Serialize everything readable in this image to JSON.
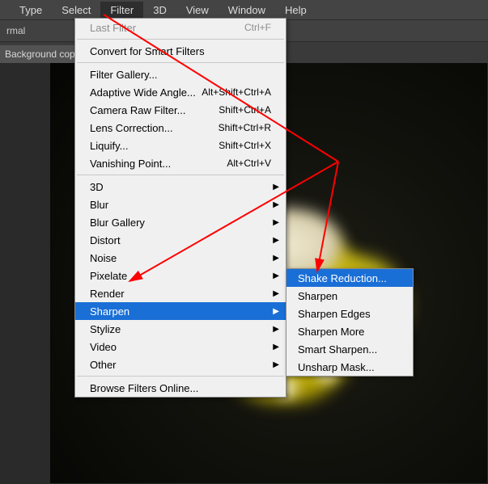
{
  "menubar": {
    "items": [
      "Type",
      "Select",
      "Filter",
      "3D",
      "View",
      "Window",
      "Help"
    ],
    "activeIndex": 2
  },
  "toolbar": {
    "mode": "rmal"
  },
  "tab": {
    "label": "Background copy"
  },
  "filterMenu": {
    "lastFilter": {
      "label": "Last Filter",
      "shortcut": "Ctrl+F"
    },
    "convertSmart": "Convert for Smart Filters",
    "filterGallery": "Filter Gallery...",
    "adaptiveWideAngle": {
      "label": "Adaptive Wide Angle...",
      "shortcut": "Alt+Shift+Ctrl+A"
    },
    "cameraRaw": {
      "label": "Camera Raw Filter...",
      "shortcut": "Shift+Ctrl+A"
    },
    "lensCorrection": {
      "label": "Lens Correction...",
      "shortcut": "Shift+Ctrl+R"
    },
    "liquify": {
      "label": "Liquify...",
      "shortcut": "Shift+Ctrl+X"
    },
    "vanishingPoint": {
      "label": "Vanishing Point...",
      "shortcut": "Alt+Ctrl+V"
    },
    "sub3d": "3D",
    "blur": "Blur",
    "blurGallery": "Blur Gallery",
    "distort": "Distort",
    "noise": "Noise",
    "pixelate": "Pixelate",
    "render": "Render",
    "sharpen": "Sharpen",
    "stylize": "Stylize",
    "video": "Video",
    "other": "Other",
    "browseOnline": "Browse Filters Online..."
  },
  "sharpenSubmenu": {
    "shakeReduction": "Shake Reduction...",
    "sharpen": "Sharpen",
    "sharpenEdges": "Sharpen Edges",
    "sharpenMore": "Sharpen More",
    "smartSharpen": "Smart Sharpen...",
    "unsharpMask": "Unsharp Mask..."
  }
}
